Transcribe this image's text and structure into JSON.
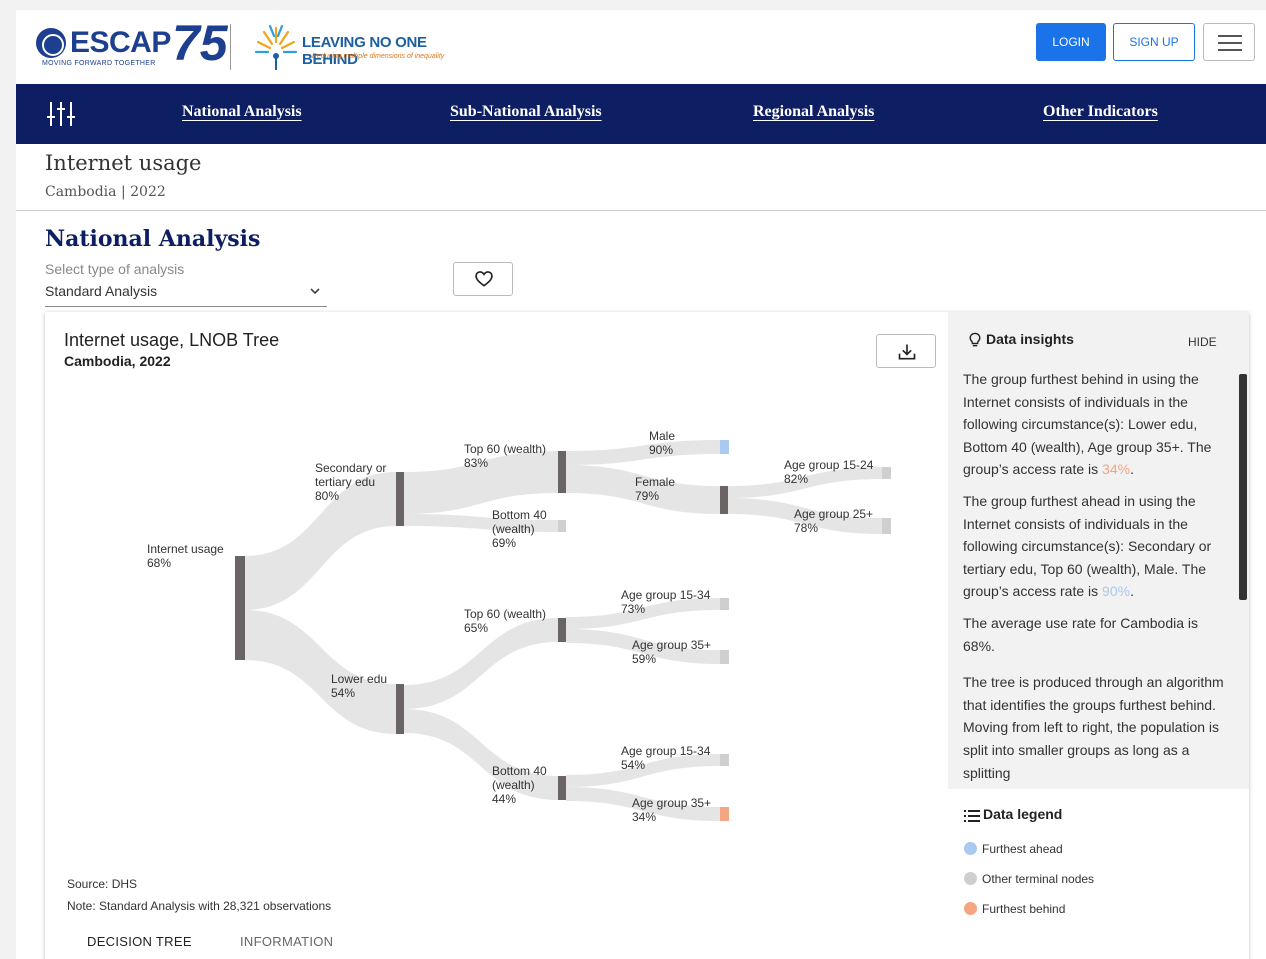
{
  "header": {
    "escap_word": "ESCAP",
    "escap_num": "75",
    "escap_tagline": "MOVING FORWARD TOGETHER",
    "lnob_title": "LEAVING NO ONE BEHIND",
    "lnob_subtitle": "Reducing multiple dimensions of inequality",
    "login_label": "LOGIN",
    "signup_label": "SIGN UP",
    "menu_icon": "hamburger-icon"
  },
  "nav": {
    "filter_icon": "sliders-icon",
    "links": [
      "National Analysis",
      "Sub-National Analysis",
      "Regional Analysis",
      "Other Indicators"
    ]
  },
  "page": {
    "title": "Internet usage",
    "subtitle": "Cambodia | 2022",
    "section_title": "National Analysis",
    "select_label": "Select type of analysis",
    "select_value": "Standard Analysis",
    "favorite_icon": "heart-icon"
  },
  "chart": {
    "title": "Internet usage, LNOB Tree",
    "subtitle": "Cambodia, 2022",
    "download_icon": "download-icon",
    "source": "Source: DHS",
    "note": "Note: Standard Analysis with 28,321 observations",
    "tabs": [
      "DECISION TREE",
      "INFORMATION"
    ]
  },
  "chart_data": {
    "type": "tree",
    "nodes": [
      {
        "id": "root",
        "label": "Internet usage",
        "value": "68%"
      },
      {
        "id": "sec",
        "parent": "root",
        "label": "Secondary or tertiary edu",
        "value": "80%"
      },
      {
        "id": "low",
        "parent": "root",
        "label": "Lower edu",
        "value": "54%"
      },
      {
        "id": "sec_top",
        "parent": "sec",
        "label": "Top 60 (wealth)",
        "value": "83%"
      },
      {
        "id": "sec_bot",
        "parent": "sec",
        "label": "Bottom 40 (wealth)",
        "value": "69%",
        "terminal": true
      },
      {
        "id": "male",
        "parent": "sec_top",
        "label": "Male",
        "value": "90%",
        "terminal": true,
        "status": "furthest_ahead"
      },
      {
        "id": "female",
        "parent": "sec_top",
        "label": "Female",
        "value": "79%"
      },
      {
        "id": "f_1524",
        "parent": "female",
        "label": "Age group 15-24",
        "value": "82%",
        "terminal": true
      },
      {
        "id": "f_25",
        "parent": "female",
        "label": "Age group 25+",
        "value": "78%",
        "terminal": true
      },
      {
        "id": "low_top",
        "parent": "low",
        "label": "Top 60 (wealth)",
        "value": "65%"
      },
      {
        "id": "low_top_1534",
        "parent": "low_top",
        "label": "Age group 15-34",
        "value": "73%",
        "terminal": true
      },
      {
        "id": "low_top_35",
        "parent": "low_top",
        "label": "Age group 35+",
        "value": "59%",
        "terminal": true
      },
      {
        "id": "low_bot",
        "parent": "low",
        "label": "Bottom 40 (wealth)",
        "value": "44%"
      },
      {
        "id": "low_bot_1534",
        "parent": "low_bot",
        "label": "Age group 15-34",
        "value": "54%",
        "terminal": true
      },
      {
        "id": "low_bot_35",
        "parent": "low_bot",
        "label": "Age group 35+",
        "value": "34%",
        "terminal": true,
        "status": "furthest_behind"
      }
    ]
  },
  "colors": {
    "furthest_ahead": "#a9c9f0",
    "other": "#cfcfcf",
    "furthest_behind": "#f4a582",
    "node_bar": "#6b6464",
    "link": "#e5e5e5",
    "nav_bg": "#0e1e63"
  },
  "insights": {
    "icon": "lightbulb-icon",
    "title": "Data insights",
    "hide_label": "HIDE",
    "p1_before": "The group furthest behind in using the Internet consists of individuals in the following circumstance(s): Lower edu, Bottom 40 (wealth), Age group 35+. The group’s access rate is ",
    "p1_value": "34%",
    "p1_after": ".",
    "p2_before": "The group furthest ahead in using the Internet consists of individuals in the following circumstance(s): Secondary or tertiary edu, Top 60 (wealth), Male. The group’s access rate is ",
    "p2_value": "90%",
    "p2_after": ".",
    "p3": "The average use rate for Cambodia is 68%.",
    "p4": "The tree is produced through an algorithm that identifies the groups furthest behind. Moving from left to right, the population is split into smaller groups as long as a splitting"
  },
  "legend": {
    "icon": "list-icon",
    "title": "Data legend",
    "items": [
      "Furthest ahead",
      "Other terminal nodes",
      "Furthest behind"
    ]
  }
}
